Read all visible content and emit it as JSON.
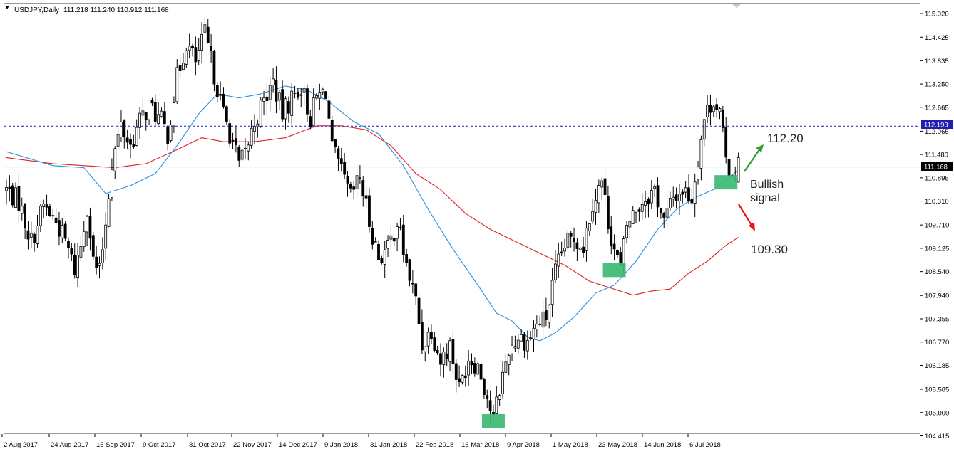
{
  "chart_data": {
    "type": "candlestick",
    "symbol_header": "USDJPY,Daily",
    "ohlc_header": "111.218 111.240 110.912 111.168",
    "last_price_label": "111.168",
    "dotted_level_label": "112.193",
    "dotted_level": 112.193,
    "last_price": 111.168,
    "ylim": [
      104.415,
      115.2
    ],
    "y_ticks": [
      "115.020",
      "114.425",
      "113.835",
      "113.250",
      "112.665",
      "112.065",
      "111.480",
      "110.895",
      "110.310",
      "109.710",
      "109.125",
      "108.540",
      "107.940",
      "107.355",
      "106.770",
      "106.185",
      "105.585",
      "105.000",
      "104.415"
    ],
    "x_labels": [
      "2 Aug 2017",
      "24 Aug 2017",
      "15 Sep 2017",
      "9 Oct 2017",
      "31 Oct 2017",
      "22 Nov 2017",
      "14 Dec 2017",
      "9 Jan 2018",
      "31 Jan 2018",
      "22 Feb 2018",
      "16 Mar 2018",
      "9 Apr 2018",
      "1 May 2018",
      "23 May 2018",
      "14 Jun 2018",
      "6 Jul 2018"
    ],
    "close_anchors": [
      [
        0,
        110.6
      ],
      [
        4,
        110.3
      ],
      [
        8,
        109.3
      ],
      [
        12,
        110.2
      ],
      [
        16,
        109.8
      ],
      [
        19,
        109.3
      ],
      [
        22,
        108.6
      ],
      [
        24,
        109.2
      ],
      [
        26,
        110.2
      ],
      [
        28,
        108.8
      ],
      [
        30,
        108.5
      ],
      [
        32,
        109.8
      ],
      [
        34,
        111.3
      ],
      [
        37,
        112.2
      ],
      [
        40,
        111.7
      ],
      [
        43,
        112.3
      ],
      [
        46,
        112.7
      ],
      [
        50,
        112.3
      ],
      [
        52,
        112.0
      ],
      [
        55,
        113.4
      ],
      [
        58,
        114.3
      ],
      [
        61,
        113.8
      ],
      [
        64,
        114.5
      ],
      [
        67,
        113.5
      ],
      [
        70,
        112.5
      ],
      [
        73,
        111.8
      ],
      [
        75,
        111.2
      ],
      [
        77,
        111.5
      ],
      [
        80,
        112.3
      ],
      [
        83,
        112.8
      ],
      [
        86,
        113.3
      ],
      [
        89,
        112.5
      ],
      [
        92,
        112.9
      ],
      [
        95,
        113.2
      ],
      [
        98,
        112.4
      ],
      [
        100,
        112.9
      ],
      [
        103,
        113.1
      ],
      [
        105,
        111.6
      ],
      [
        108,
        111.0
      ],
      [
        111,
        110.4
      ],
      [
        114,
        110.9
      ],
      [
        117,
        109.8
      ],
      [
        120,
        108.9
      ],
      [
        123,
        109.1
      ],
      [
        126,
        109.8
      ],
      [
        129,
        108.7
      ],
      [
        132,
        107.8
      ],
      [
        134,
        106.7
      ],
      [
        137,
        107.1
      ],
      [
        140,
        106.3
      ],
      [
        143,
        106.7
      ],
      [
        146,
        105.6
      ],
      [
        149,
        106.4
      ],
      [
        152,
        106.2
      ],
      [
        155,
        105.4
      ],
      [
        157,
        104.8
      ],
      [
        159,
        105.6
      ],
      [
        162,
        106.6
      ],
      [
        165,
        106.9
      ],
      [
        168,
        106.8
      ],
      [
        171,
        107.2
      ],
      [
        174,
        107.4
      ],
      [
        177,
        108.5
      ],
      [
        180,
        109.2
      ],
      [
        183,
        109.4
      ],
      [
        186,
        109.2
      ],
      [
        189,
        110.3
      ],
      [
        192,
        110.8
      ],
      [
        194,
        109.8
      ],
      [
        196,
        109.1
      ],
      [
        198,
        108.6
      ],
      [
        200,
        109.7
      ],
      [
        203,
        110.1
      ],
      [
        206,
        110.4
      ],
      [
        209,
        110.6
      ],
      [
        212,
        109.8
      ],
      [
        215,
        110.4
      ],
      [
        218,
        110.6
      ],
      [
        221,
        110.4
      ],
      [
        223,
        111.4
      ],
      [
        225,
        112.4
      ],
      [
        228,
        112.9
      ],
      [
        230,
        112.5
      ],
      [
        232,
        111.3
      ],
      [
        234,
        111.0
      ],
      [
        236,
        111.2
      ]
    ],
    "ma_blue": [
      [
        0,
        111.55
      ],
      [
        15,
        111.2
      ],
      [
        25,
        111.15
      ],
      [
        32,
        110.5
      ],
      [
        40,
        110.7
      ],
      [
        48,
        111.0
      ],
      [
        55,
        111.7
      ],
      [
        62,
        112.5
      ],
      [
        68,
        113.0
      ],
      [
        75,
        112.9
      ],
      [
        82,
        113.0
      ],
      [
        90,
        113.2
      ],
      [
        97,
        113.1
      ],
      [
        104,
        112.8
      ],
      [
        112,
        112.3
      ],
      [
        120,
        112.0
      ],
      [
        128,
        111.2
      ],
      [
        136,
        110.1
      ],
      [
        144,
        109.1
      ],
      [
        152,
        108.2
      ],
      [
        158,
        107.5
      ],
      [
        163,
        107.3
      ],
      [
        168,
        106.9
      ],
      [
        172,
        106.8
      ],
      [
        177,
        107.0
      ],
      [
        183,
        107.4
      ],
      [
        190,
        108.0
      ],
      [
        196,
        108.2
      ],
      [
        203,
        108.8
      ],
      [
        210,
        109.6
      ],
      [
        216,
        110.1
      ],
      [
        222,
        110.4
      ],
      [
        228,
        110.6
      ],
      [
        233,
        110.9
      ],
      [
        236,
        111.1
      ]
    ],
    "ma_red": [
      [
        0,
        111.4
      ],
      [
        15,
        111.25
      ],
      [
        25,
        111.2
      ],
      [
        35,
        111.15
      ],
      [
        45,
        111.25
      ],
      [
        55,
        111.6
      ],
      [
        63,
        111.9
      ],
      [
        70,
        111.8
      ],
      [
        80,
        111.8
      ],
      [
        90,
        111.9
      ],
      [
        100,
        112.2
      ],
      [
        108,
        112.2
      ],
      [
        116,
        112.1
      ],
      [
        124,
        111.7
      ],
      [
        132,
        111.0
      ],
      [
        140,
        110.6
      ],
      [
        148,
        110.0
      ],
      [
        156,
        109.6
      ],
      [
        164,
        109.3
      ],
      [
        172,
        109.0
      ],
      [
        180,
        108.7
      ],
      [
        188,
        108.3
      ],
      [
        196,
        108.1
      ],
      [
        202,
        107.95
      ],
      [
        208,
        108.05
      ],
      [
        214,
        108.1
      ],
      [
        220,
        108.5
      ],
      [
        226,
        108.8
      ],
      [
        232,
        109.2
      ],
      [
        236,
        109.4
      ]
    ],
    "highlight_boxes": [
      [
        157,
        104.8
      ],
      [
        196,
        108.6
      ],
      [
        232,
        110.8
      ]
    ],
    "annotations": {
      "target_up": "112.20",
      "target_down": "109.30",
      "signal_line1": "Bullish",
      "signal_line2": "signal"
    },
    "colors": {
      "candle": "#000000",
      "ma_fast": "#2b8fe0",
      "ma_slow": "#dd2020",
      "level_line": "#1f1faf",
      "last_price_line": "#b4b4b4",
      "highlight": "#3dba74",
      "arrow_up": "#2ba02b",
      "arrow_down": "#e01818"
    }
  }
}
